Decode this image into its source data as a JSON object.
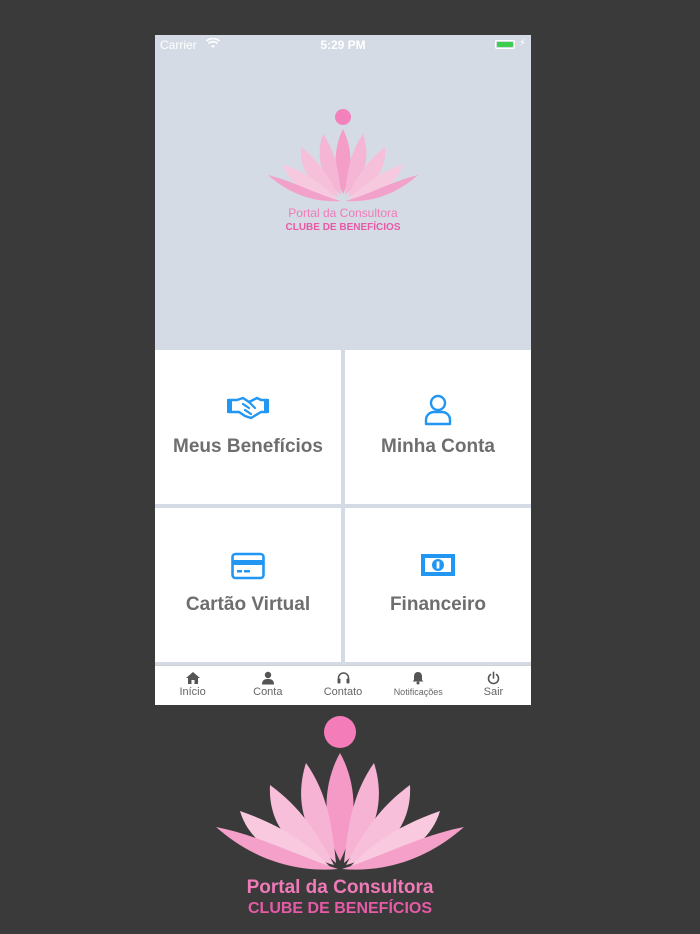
{
  "status_bar": {
    "carrier": "Carrier",
    "time": "5:29 PM"
  },
  "logo": {
    "line1": "Portal da Consultora",
    "line2": "CLUBE DE BENEFÍCIOS"
  },
  "tiles": [
    {
      "label": "Meus Benefícios",
      "icon": "handshake-icon"
    },
    {
      "label": "Minha Conta",
      "icon": "user-icon"
    },
    {
      "label": "Cartão Virtual",
      "icon": "credit-card-icon"
    },
    {
      "label": "Financeiro",
      "icon": "money-bill-icon"
    }
  ],
  "tabbar": {
    "items": [
      {
        "label": "Início",
        "icon": "home-icon"
      },
      {
        "label": "Conta",
        "icon": "user-icon"
      },
      {
        "label": "Contato",
        "icon": "headset-icon"
      },
      {
        "label": "Notificações",
        "icon": "bell-icon"
      },
      {
        "label": "Sair",
        "icon": "power-icon"
      }
    ]
  },
  "colors": {
    "accent_blue": "#2196f3",
    "logo_pink": "#f07ab8",
    "hero_bg": "#d5dbe5",
    "outer_bg": "#3a3a3a"
  }
}
